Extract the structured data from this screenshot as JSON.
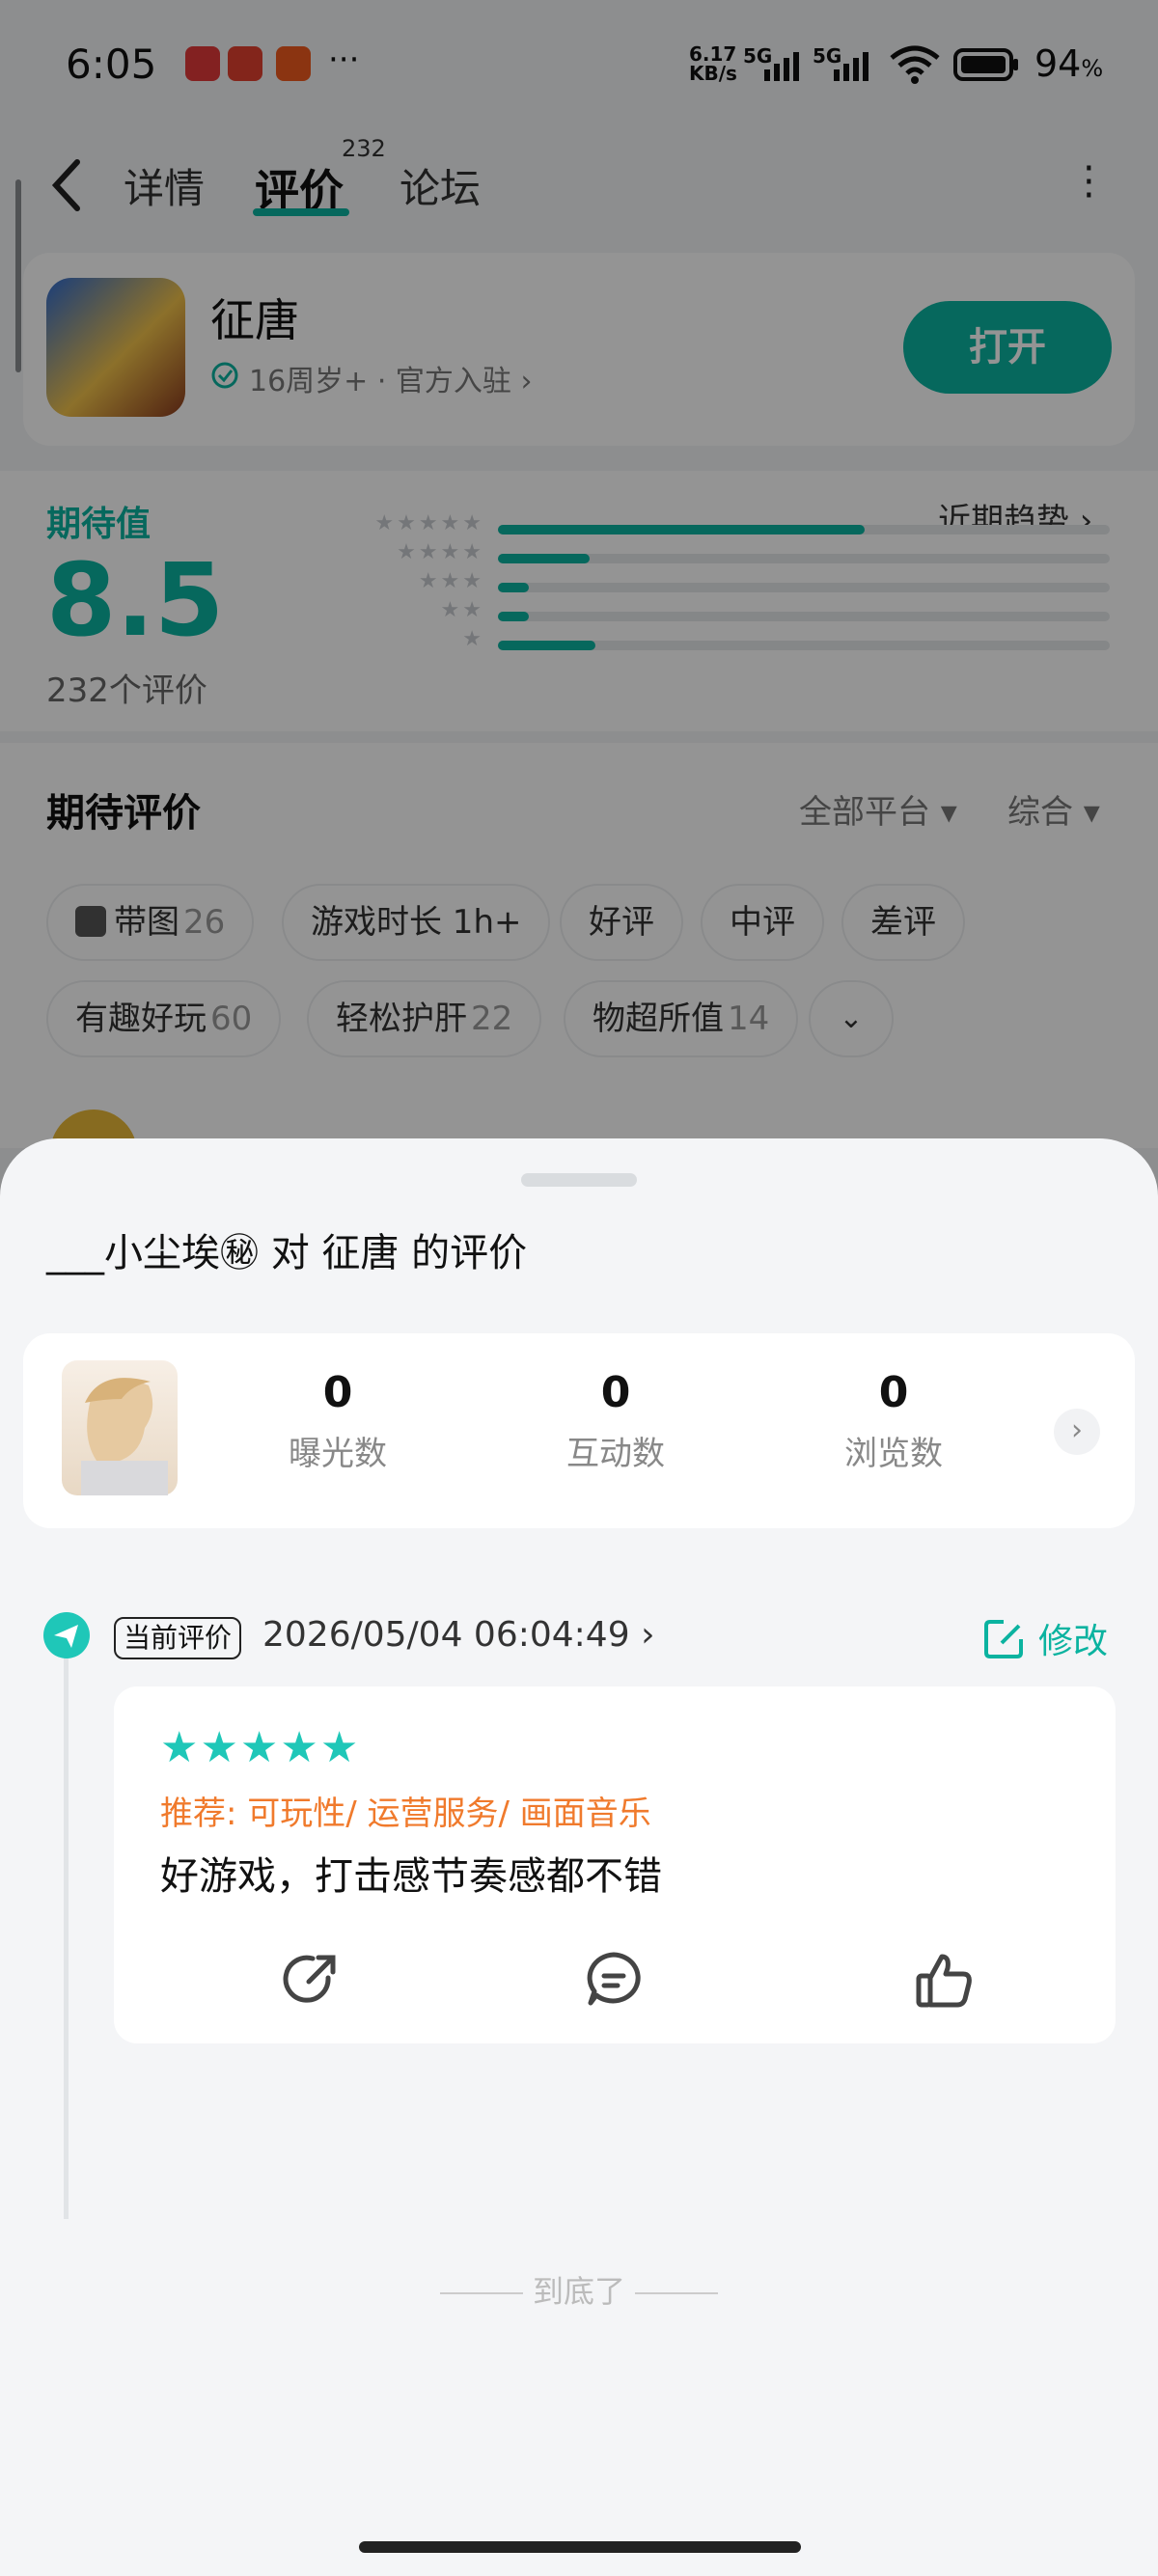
{
  "status_bar": {
    "time": "6:05",
    "net_speed_top": "6.17",
    "net_speed_unit": "KB/s",
    "sig1": "5G",
    "sig2": "5G",
    "battery": "94",
    "battery_unit": "%"
  },
  "nav": {
    "tab_detail": "详情",
    "tab_reviews": "评价",
    "review_count_badge": "232",
    "tab_forum": "论坛"
  },
  "app": {
    "name": "征唐",
    "meta": "16周岁+ · 官方入驻",
    "open_label": "打开"
  },
  "rating": {
    "label": "期待值",
    "score": "8.5",
    "count_text": "232个评价",
    "trend_label": "近期趋势",
    "distribution": [
      0.6,
      0.15,
      0.05,
      0.05,
      0.16
    ]
  },
  "reviews_section": {
    "title": "期待评价",
    "platform_filter": "全部平台",
    "sort_filter": "综合",
    "chips_row1": [
      {
        "label": "带图",
        "count": "26"
      },
      {
        "label": "游戏时长 1h+",
        "count": ""
      },
      {
        "label": "好评",
        "count": ""
      },
      {
        "label": "中评",
        "count": ""
      },
      {
        "label": "差评",
        "count": ""
      }
    ],
    "chips_row2": [
      {
        "label": "有趣好玩",
        "count": "60"
      },
      {
        "label": "轻松护肝",
        "count": "22"
      },
      {
        "label": "物超所值",
        "count": "14"
      }
    ]
  },
  "sheet": {
    "title": "___小尘埃㊙ 对 征唐 的评价",
    "stats": [
      {
        "value": "0",
        "label": "曝光数"
      },
      {
        "value": "0",
        "label": "互动数"
      },
      {
        "value": "0",
        "label": "浏览数"
      }
    ],
    "current_tag": "当前评价",
    "timestamp": "2026/05/04 06:04:49",
    "edit_label": "修改",
    "stars": 5,
    "recommend": "推荐: 可玩性/ 运营服务/ 画面音乐",
    "review_text": "好游戏，打击感节奏感都不错",
    "end_text": "到底了"
  },
  "colors": {
    "accent": "#0bb3a0",
    "star": "#1fc7b8",
    "recommend": "#f07a2c"
  }
}
